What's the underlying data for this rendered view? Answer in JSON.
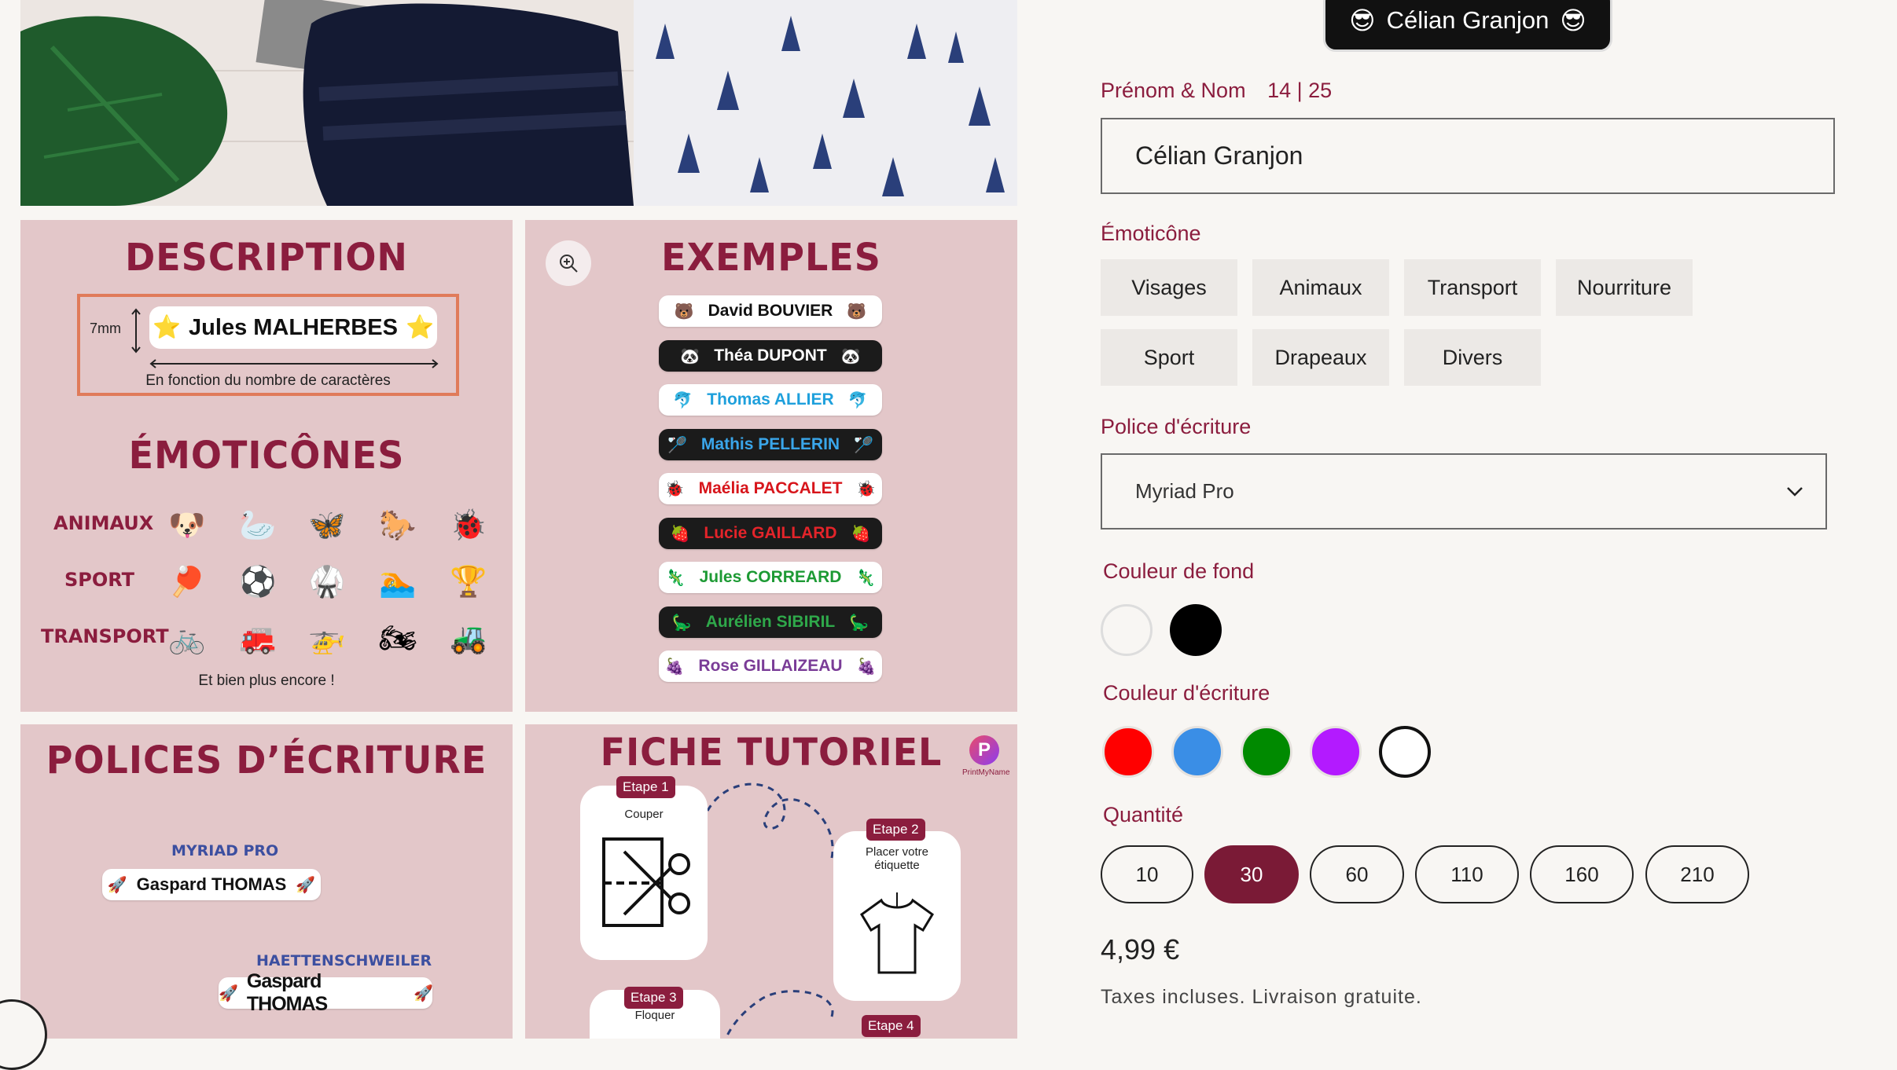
{
  "preview": {
    "label": "Célian Granjon",
    "emoji": "😎"
  },
  "gallery": {
    "description": {
      "title": "DESCRIPTION",
      "height_label": "7mm",
      "sample_name": "Jules MALHERBES",
      "sample_emoji": "⭐",
      "width_caption": "En fonction du nombre de caractères"
    },
    "emoticones": {
      "title": "ÉMOTICÔNES",
      "rows": [
        {
          "label": "ANIMAUX",
          "icons": [
            "🐶",
            "🦢",
            "🦋",
            "🐎",
            "🐞"
          ]
        },
        {
          "label": "SPORT",
          "icons": [
            "🏓",
            "⚽",
            "🥋",
            "🏊",
            "🏆"
          ]
        },
        {
          "label": "TRANSPORT",
          "icons": [
            "🚲",
            "🚒",
            "🚁",
            "🏍",
            "🚜"
          ]
        }
      ],
      "footer": "Et bien plus encore !"
    },
    "exemples": {
      "title": "EXEMPLES",
      "items": [
        {
          "name": "David BOUVIER",
          "emoji": "🐻",
          "bg": "#ffffff",
          "color": "#111111"
        },
        {
          "name": "Théa DUPONT",
          "emoji": "🐼",
          "bg": "#1b1b1b",
          "color": "#ffffff"
        },
        {
          "name": "Thomas ALLIER",
          "emoji": "🐬",
          "bg": "#ffffff",
          "color": "#1ea0dc"
        },
        {
          "name": "Mathis PELLERIN",
          "emoji": "🏸",
          "bg": "#1b1b1b",
          "color": "#3aa6ea"
        },
        {
          "name": "Maélia PACCALET",
          "emoji": "🐞",
          "bg": "#ffffff",
          "color": "#d7151b"
        },
        {
          "name": "Lucie GAILLARD",
          "emoji": "🍓",
          "bg": "#1b1b1b",
          "color": "#e4242a"
        },
        {
          "name": "Jules CORREARD",
          "emoji": "🦎",
          "bg": "#ffffff",
          "color": "#1d9a34"
        },
        {
          "name": "Aurélien SIBIRIL",
          "emoji": "🦕",
          "bg": "#1b1b1b",
          "color": "#2fa84a"
        },
        {
          "name": "Rose GILLAIZEAU",
          "emoji": "🍇",
          "bg": "#ffffff",
          "color": "#7a3c97"
        }
      ]
    },
    "polices": {
      "title": "POLICES D’ÉCRITURE",
      "fonts": [
        {
          "label": "MYRIAD PRO",
          "sample": "Gaspard THOMAS",
          "emoji": "🚀"
        },
        {
          "label": "HAETTENSCHWEILER",
          "sample": "Gaspard THOMAS",
          "emoji": "🚀"
        }
      ]
    },
    "tutoriel": {
      "title": "FICHE TUTORIEL",
      "brand": "PrintMyName",
      "brand_letter": "P",
      "steps": [
        {
          "tag": "Etape 1",
          "desc": "Couper"
        },
        {
          "tag": "Etape 2",
          "desc": "Placer votre étiquette"
        },
        {
          "tag": "Etape 3",
          "desc": "Floquer"
        },
        {
          "tag": "Etape 4",
          "desc": ""
        }
      ]
    },
    "zoom_icon": "zoom-in-icon"
  },
  "form": {
    "name_label": "Prénom & Nom",
    "char_count": "14 | 25",
    "name_value": "Célian Granjon",
    "emoticone_label": "Émoticône",
    "emoticone_tabs": [
      "Visages",
      "Animaux",
      "Transport",
      "Nourriture",
      "Sport",
      "Drapeaux",
      "Divers"
    ],
    "font_label": "Police d'écriture",
    "font_selected": "Myriad Pro",
    "bg_color_label": "Couleur de fond",
    "bg_colors": [
      "#f8f6f3",
      "#000000"
    ],
    "text_color_label": "Couleur d'écriture",
    "text_colors": [
      "#ff0000",
      "#3a8ee6",
      "#008a00",
      "#b31aff",
      "#ffffff"
    ],
    "quantity_label": "Quantité",
    "quantities": [
      "10",
      "30",
      "60",
      "110",
      "160",
      "210"
    ],
    "quantity_selected": "30",
    "price": "4,99 €",
    "tax_note": "Taxes incluses. Livraison gratuite.",
    "accent": "#7a1a36"
  }
}
